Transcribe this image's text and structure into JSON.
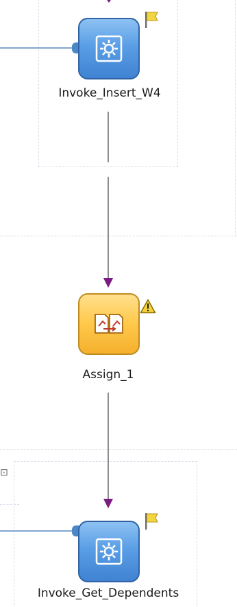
{
  "nodes": {
    "invoke_insert": {
      "label": "Invoke_Insert_W4",
      "type": "invoke",
      "badge": "flag-icon"
    },
    "assign": {
      "label": "Assign_1",
      "type": "assign",
      "badge": "warning-icon"
    },
    "invoke_get": {
      "label": "Invoke_Get_Dependents",
      "type": "invoke",
      "badge": "flag-icon"
    }
  },
  "colors": {
    "invoke_fill": "#5a9ee6",
    "assign_fill": "#ffc84a",
    "arrowhead": "#7a1c82",
    "connector": "#8c8c8c",
    "partner_link": "#7fa6cf",
    "scope_border": "#d9dcea",
    "flag": "#f2d640",
    "warning": "#f5d13b"
  }
}
